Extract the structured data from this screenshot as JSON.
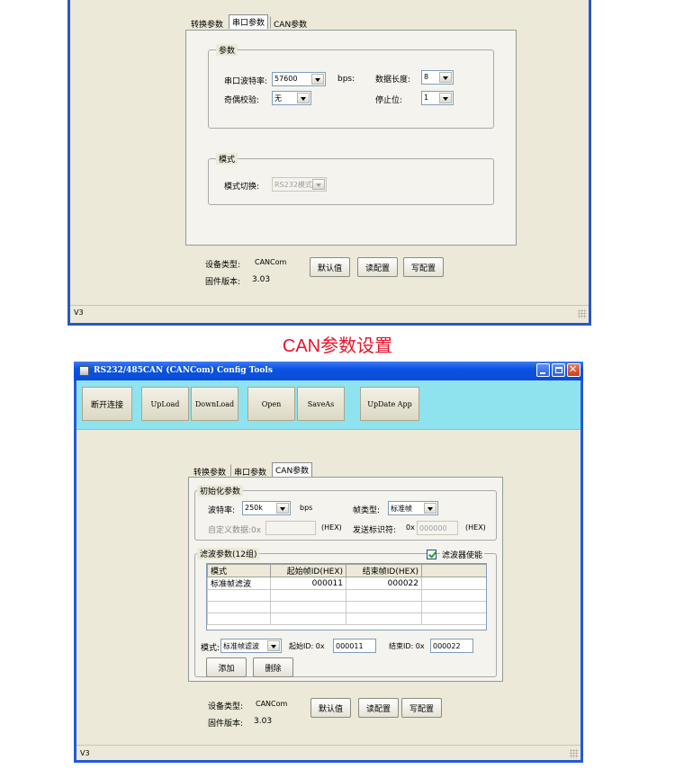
{
  "top_window": {
    "tabs": [
      "转换参数",
      "串口参数",
      "CAN参数"
    ],
    "selected_tab": 1,
    "params_group": {
      "title": "参数",
      "baud_label": "串口波特率:",
      "baud_value": "57600",
      "baud_unit": "bps:",
      "data_len_label": "数据长度:",
      "data_len_value": "8",
      "parity_label": "奇偶校验:",
      "parity_value": "无",
      "stop_label": "停止位:",
      "stop_value": "1"
    },
    "mode_group": {
      "title": "模式",
      "switch_label": "模式切换:",
      "switch_value": "RS232模式"
    },
    "device_type_label": "设备类型:",
    "device_type_value": "CANCom",
    "firmware_label": "固件版本:",
    "firmware_value": "3.03",
    "buttons": {
      "default": "默认值",
      "read": "读配置",
      "write": "写配置"
    },
    "status": "V3"
  },
  "section_caption": "CAN参数设置",
  "section_caption_color": "#e8132c",
  "bottom_window": {
    "title": "RS232/485CAN (CANCom) Config Tools",
    "toolbar": {
      "disconnect": "断开连接",
      "upload": "UpLoad",
      "download": "DownLoad",
      "open": "Open",
      "saveas": "SaveAs",
      "update_app": "UpDate App"
    },
    "toolbar_bg": "#8fe3ee",
    "tabs": [
      "转换参数",
      "串口参数",
      "CAN参数"
    ],
    "selected_tab": 2,
    "init_group": {
      "title": "初始化参数",
      "baud_label": "波特率:",
      "baud_value": "250k",
      "baud_unit": "bps",
      "frame_type_label": "帧类型:",
      "frame_type_value": "标准帧",
      "custom_label": "自定义数据:0x",
      "custom_value": "",
      "custom_hex": "(HEX)",
      "send_id_label": "发送标识符:",
      "send_id_prefix": "0x",
      "send_id_value": "000000",
      "send_id_hex": "(HEX)"
    },
    "filter_group": {
      "title": "滤波参数(12组)",
      "enable_label": "滤波器使能",
      "enable_checked": true,
      "columns": [
        "模式",
        "起始帧ID(HEX)",
        "结束帧ID(HEX)"
      ],
      "rows": [
        [
          "标准帧滤波",
          "000011",
          "000022"
        ]
      ],
      "mode_label": "模式:",
      "mode_value": "标准帧滤波",
      "start_label": "起始ID: 0x",
      "start_value": "000011",
      "end_label": "结束ID: 0x",
      "end_value": "000022",
      "add_button": "添加",
      "delete_button": "删除"
    },
    "device_type_label": "设备类型:",
    "device_type_value": "CANCom",
    "firmware_label": "固件版本:",
    "firmware_value": "3.03",
    "buttons": {
      "default": "默认值",
      "read": "读配置",
      "write": "写配置"
    },
    "status": "V3"
  }
}
